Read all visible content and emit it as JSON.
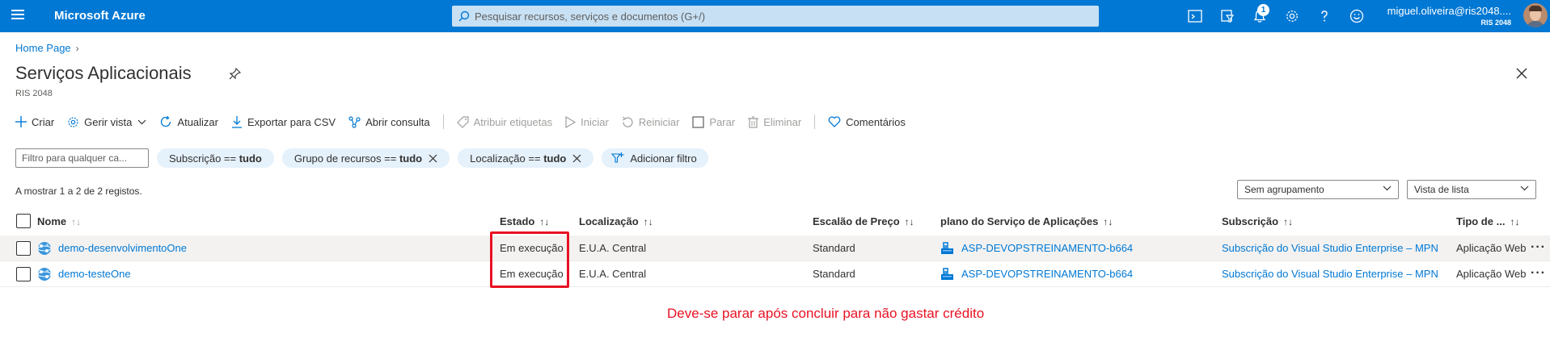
{
  "topbar": {
    "brand": "Microsoft Azure",
    "search_placeholder": "Pesquisar recursos, serviços e documentos (G+/)",
    "notification_count": "1",
    "user": "miguel.oliveira@ris2048....",
    "tenant": "RIS 2048",
    "icons": [
      "cloud-shell-icon",
      "directory-filter-icon",
      "notifications-icon",
      "settings-icon",
      "help-icon",
      "feedback-smiley-icon"
    ]
  },
  "breadcrumb": {
    "home": "Home Page"
  },
  "page": {
    "title": "Serviços Aplicacionais",
    "subtitle": "RIS 2048"
  },
  "commands": {
    "create": "Criar",
    "manage_view": "Gerir vista",
    "refresh": "Atualizar",
    "export_csv": "Exportar para CSV",
    "open_query": "Abrir consulta",
    "assign_tags": "Atribuir etiquetas",
    "start": "Iniciar",
    "restart": "Reiniciar",
    "stop": "Parar",
    "delete": "Eliminar",
    "feedback": "Comentários"
  },
  "filters": {
    "placeholder": "Filtro para qualquer ca...",
    "subscription": {
      "label": "Subscrição == ",
      "value": "tudo"
    },
    "resource_group": {
      "label": "Grupo de recursos == ",
      "value": "tudo"
    },
    "location": {
      "label": "Localização == ",
      "value": "tudo"
    },
    "add_filter": "Adicionar filtro"
  },
  "record_count": "A mostrar 1 a 2 de 2 registos.",
  "grouping": "Sem agrupamento",
  "view_mode": "Vista de lista",
  "table": {
    "columns": {
      "name": "Nome",
      "status": "Estado",
      "location": "Localização",
      "pricing_tier": "Escalão de Preço",
      "app_service_plan": "plano do Serviço de Aplicações",
      "subscription": "Subscrição",
      "type": "Tipo de ..."
    },
    "rows": [
      {
        "name": "demo-desenvolvimentoOne",
        "status": "Em execução",
        "location": "E.U.A. Central",
        "pricing_tier": "Standard",
        "app_service_plan": "ASP-DEVOPSTREINAMENTO-b664",
        "subscription": "Subscrição do Visual Studio Enterprise – MPN",
        "type": "Aplicação Web"
      },
      {
        "name": "demo-testeOne",
        "status": "Em execução",
        "location": "E.U.A. Central",
        "pricing_tier": "Standard",
        "app_service_plan": "ASP-DEVOPSTREINAMENTO-b664",
        "subscription": "Subscrição do Visual Studio Enterprise – MPN",
        "type": "Aplicação Web"
      }
    ]
  },
  "annotation": "Deve-se parar após concluir para não gastar crédito",
  "colors": {
    "accent": "#0078d4",
    "annotation": "#e81123",
    "pill": "#e5f1fb"
  }
}
